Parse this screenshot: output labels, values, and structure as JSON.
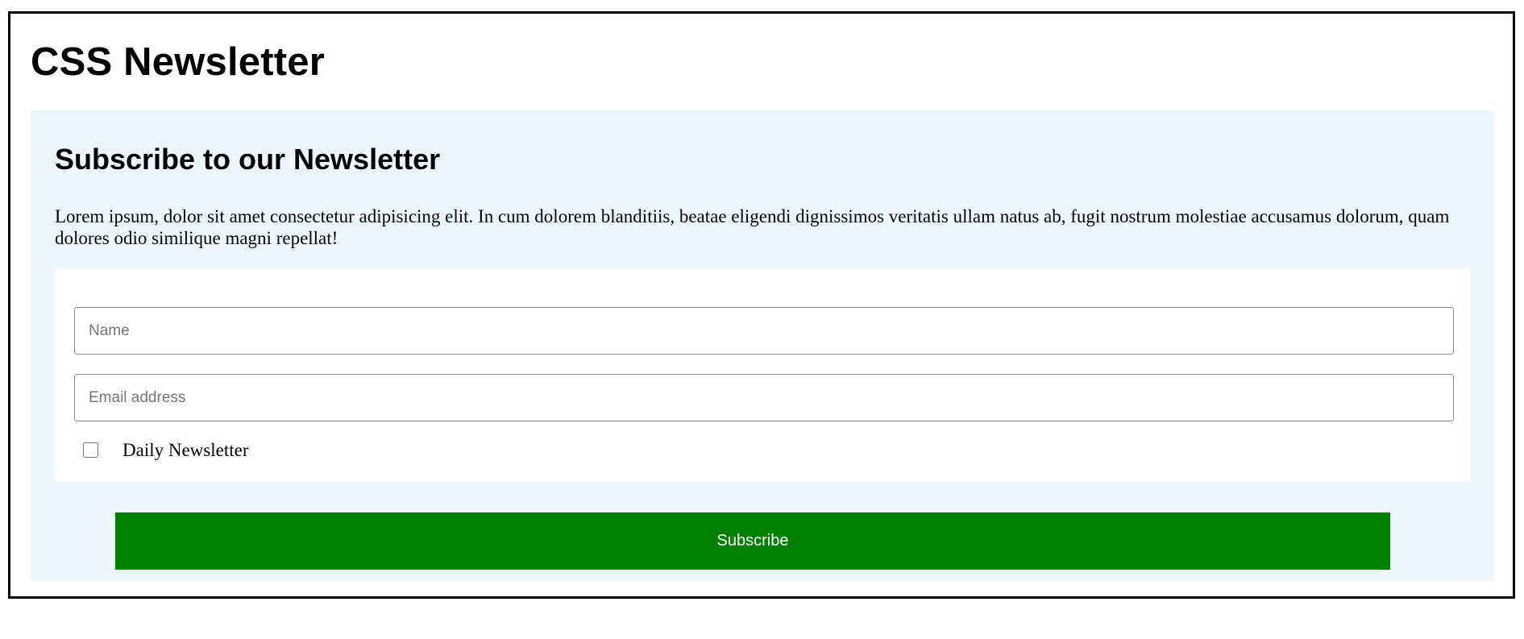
{
  "site": {
    "title": "CSS Newsletter"
  },
  "newsletter": {
    "heading": "Subscribe to our Newsletter",
    "description": "Lorem ipsum, dolor sit amet consectetur adipisicing elit. In cum dolorem blanditiis, beatae eligendi dignissimos veritatis ullam natus ab, fugit nostrum molestiae accusamus dolorum, quam dolores odio similique magni repellat!",
    "form": {
      "name_placeholder": "Name",
      "name_value": "",
      "email_placeholder": "Email address",
      "email_value": "",
      "checkbox_label": "Daily Newsletter",
      "checkbox_checked": false
    },
    "subscribe_label": "Subscribe"
  },
  "colors": {
    "panel_background": "#eef6fd",
    "button_background": "#008000",
    "button_text": "#ffffff",
    "frame_border": "#000000"
  }
}
